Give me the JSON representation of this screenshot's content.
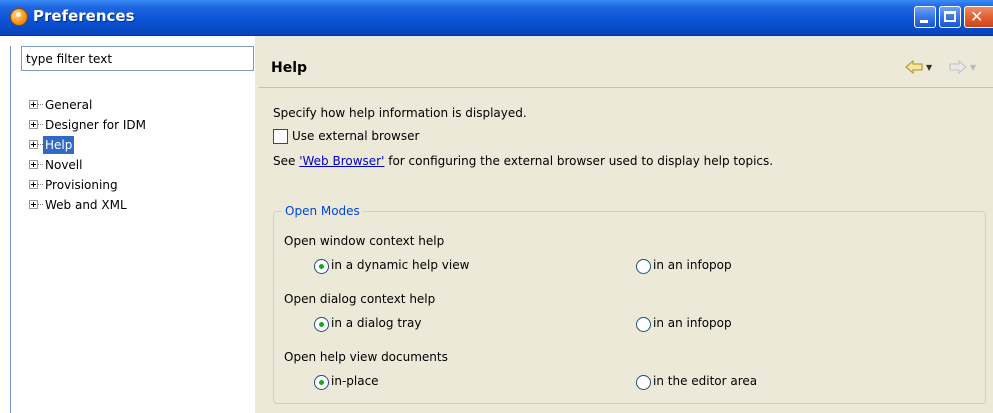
{
  "window": {
    "title": "Preferences"
  },
  "sidebar": {
    "filter_placeholder": "type filter text",
    "items": [
      {
        "label": "General",
        "selected": false
      },
      {
        "label": "Designer for IDM",
        "selected": false
      },
      {
        "label": "Help",
        "selected": true
      },
      {
        "label": "Novell",
        "selected": false
      },
      {
        "label": "Provisioning",
        "selected": false
      },
      {
        "label": "Web and XML",
        "selected": false
      }
    ]
  },
  "page": {
    "title": "Help",
    "description": "Specify how help information is displayed.",
    "external_browser": {
      "label": "Use external browser",
      "checked": false
    },
    "see_prefix": "See ",
    "see_link": "'Web Browser'",
    "see_suffix": " for configuring the external browser used to display help topics.",
    "open_modes": {
      "legend": "Open Modes",
      "window_context": {
        "label": "Open window context help",
        "option_a": "in a dynamic help view",
        "option_b": "in an infopop",
        "selected": "option_a"
      },
      "dialog_context": {
        "label": "Open dialog context help",
        "option_a": "in a dialog tray",
        "option_b": "in an infopop",
        "selected": "option_a"
      },
      "view_documents": {
        "label": "Open help view documents",
        "option_a": "in-place",
        "option_b": "in the editor area",
        "selected": "option_a"
      }
    }
  },
  "colors": {
    "titlebar": "#0a52d6",
    "selection": "#316ac5",
    "link": "#0000cc",
    "legend": "#0046d5",
    "panel": "#ece9d8"
  }
}
